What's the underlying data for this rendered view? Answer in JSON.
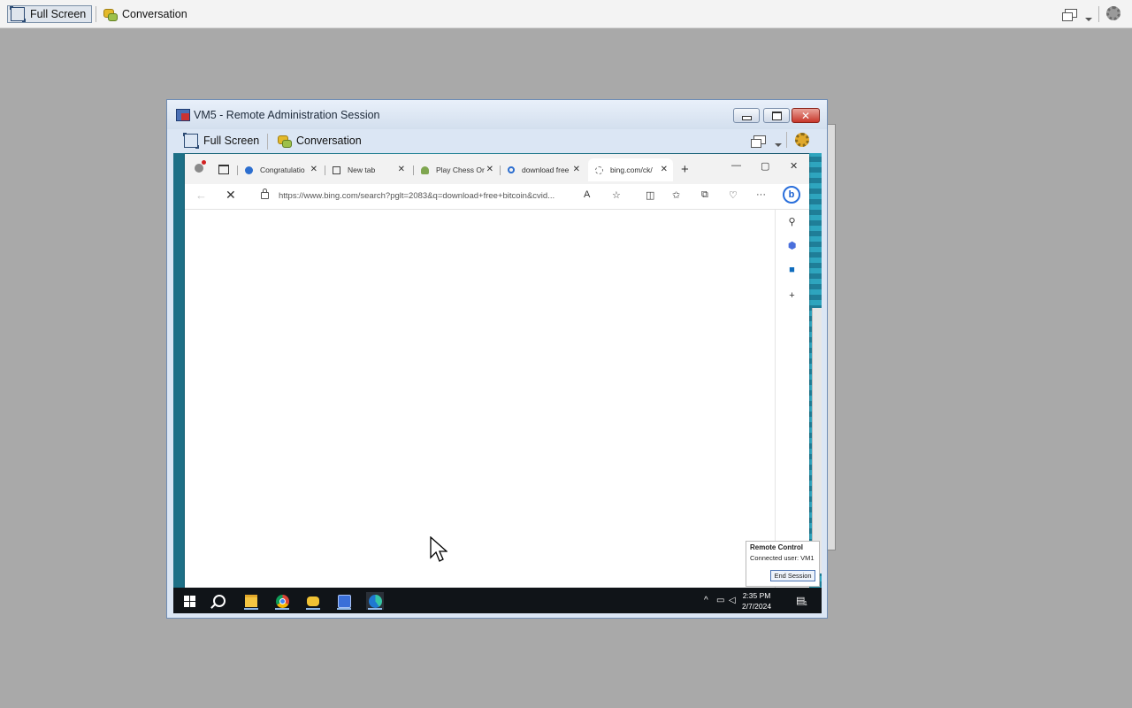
{
  "top_toolbar": {
    "full_screen_label": "Full Screen",
    "conversation_label": "Conversation"
  },
  "session_window": {
    "title": "VM5 - Remote Administration Session",
    "close_glyph": "✕",
    "toolbar": {
      "full_screen_label": "Full Screen",
      "conversation_label": "Conversation"
    }
  },
  "browser": {
    "tabs": [
      {
        "label": "Congratulatio",
        "icon": "link-icon"
      },
      {
        "label": "New tab",
        "icon": "newtab-icon"
      },
      {
        "label": "Play Chess Or",
        "icon": "chess-pawn-icon"
      },
      {
        "label": "download free",
        "icon": "search-icon"
      },
      {
        "label": "bing.com/ck/",
        "icon": "loading-icon",
        "active": true
      }
    ],
    "tab_close": "✕",
    "new_tab": "+",
    "url": "https://www.bing.com/search?pglt=2083&q=download+free+bitcoin&cvid...",
    "window_controls": {
      "minimize": "—",
      "maximize": "▢",
      "close": "✕"
    }
  },
  "taskbar": {
    "clock_time": "2:35 PM",
    "clock_date": "2/7/2024",
    "notification_count": "1"
  },
  "remote_control_popup": {
    "title": "Remote Control",
    "subtitle": "Connected user: VM1",
    "end_button": "End Session"
  }
}
